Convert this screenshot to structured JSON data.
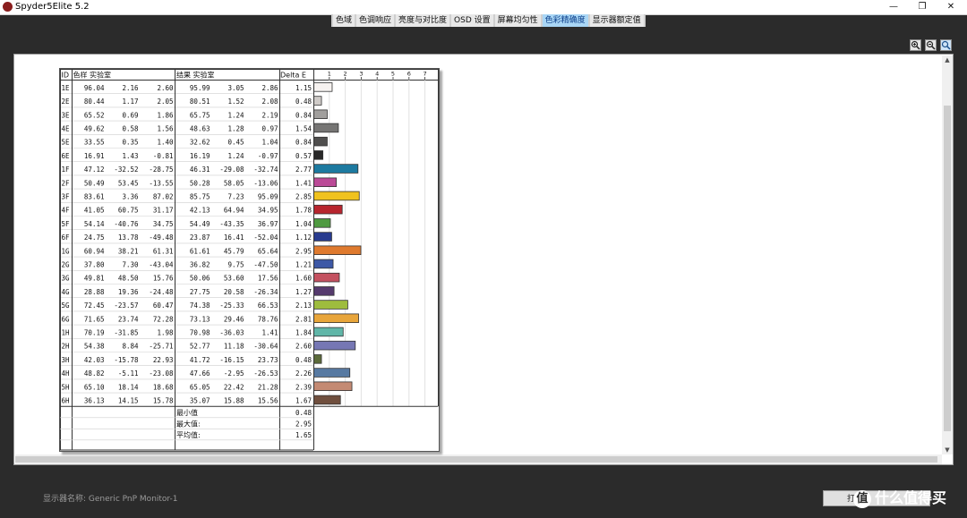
{
  "window": {
    "title": "Spyder5Elite 5.2",
    "minimize_glyph": "—",
    "restore_glyph": "❐",
    "close_glyph": "✕"
  },
  "tabs": [
    {
      "label": "色域",
      "active": false
    },
    {
      "label": "色调响应",
      "active": false
    },
    {
      "label": "亮度与对比度",
      "active": false
    },
    {
      "label": "OSD 设置",
      "active": false
    },
    {
      "label": "屏幕均匀性",
      "active": false
    },
    {
      "label": "色彩精确度",
      "active": true
    },
    {
      "label": "显示器额定值",
      "active": false
    }
  ],
  "toolbar": {
    "icons": [
      "zoom-in-icon",
      "zoom-out-icon",
      "zoom-fit-icon"
    ]
  },
  "report": {
    "headers": {
      "id": "ID",
      "sample": "色样 实验室",
      "result": "结果 实验室",
      "delta": "Delta E"
    },
    "scale_ticks": [
      "1",
      "2",
      "3",
      "4",
      "5",
      "6",
      "7"
    ],
    "rows": [
      {
        "id": "1E",
        "sample": [
          "96.04",
          "2.16",
          "2.60"
        ],
        "result": [
          "95.99",
          "3.05",
          "2.86"
        ],
        "delta": "1.15",
        "color": "#f6f2f0"
      },
      {
        "id": "2E",
        "sample": [
          "80.44",
          "1.17",
          "2.05"
        ],
        "result": [
          "80.51",
          "1.52",
          "2.08"
        ],
        "delta": "0.48",
        "color": "#cfcbc8"
      },
      {
        "id": "3E",
        "sample": [
          "65.52",
          "0.69",
          "1.86"
        ],
        "result": [
          "65.75",
          "1.24",
          "2.19"
        ],
        "delta": "0.84",
        "color": "#a19f9d"
      },
      {
        "id": "4E",
        "sample": [
          "49.62",
          "0.58",
          "1.56"
        ],
        "result": [
          "48.63",
          "1.28",
          "0.97"
        ],
        "delta": "1.54",
        "color": "#767574"
      },
      {
        "id": "5E",
        "sample": [
          "33.55",
          "0.35",
          "1.40"
        ],
        "result": [
          "32.62",
          "0.45",
          "1.04"
        ],
        "delta": "0.84",
        "color": "#4f4e4d"
      },
      {
        "id": "6E",
        "sample": [
          "16.91",
          "1.43",
          "-0.81"
        ],
        "result": [
          "16.19",
          "1.24",
          "-0.97"
        ],
        "delta": "0.57",
        "color": "#292828"
      },
      {
        "id": "1F",
        "sample": [
          "47.12",
          "-32.52",
          "-28.75"
        ],
        "result": [
          "46.31",
          "-29.08",
          "-32.74"
        ],
        "delta": "2.77",
        "color": "#1d7aa0"
      },
      {
        "id": "2F",
        "sample": [
          "50.49",
          "53.45",
          "-13.55"
        ],
        "result": [
          "50.28",
          "58.05",
          "-13.06"
        ],
        "delta": "1.41",
        "color": "#bb4a97"
      },
      {
        "id": "3F",
        "sample": [
          "83.61",
          "3.36",
          "87.02"
        ],
        "result": [
          "85.75",
          "7.23",
          "95.09"
        ],
        "delta": "2.85",
        "color": "#f0c21e"
      },
      {
        "id": "4F",
        "sample": [
          "41.05",
          "60.75",
          "31.17"
        ],
        "result": [
          "42.13",
          "64.94",
          "34.95"
        ],
        "delta": "1.78",
        "color": "#b8252e"
      },
      {
        "id": "5F",
        "sample": [
          "54.14",
          "-40.76",
          "34.75"
        ],
        "result": [
          "54.49",
          "-43.35",
          "36.97"
        ],
        "delta": "1.04",
        "color": "#4f9a41"
      },
      {
        "id": "6F",
        "sample": [
          "24.75",
          "13.78",
          "-49.48"
        ],
        "result": [
          "23.87",
          "16.41",
          "-52.04"
        ],
        "delta": "1.12",
        "color": "#283b8e"
      },
      {
        "id": "1G",
        "sample": [
          "60.94",
          "38.21",
          "61.31"
        ],
        "result": [
          "61.61",
          "45.79",
          "65.64"
        ],
        "delta": "2.95",
        "color": "#df7a2e"
      },
      {
        "id": "2G",
        "sample": [
          "37.80",
          "7.30",
          "-43.04"
        ],
        "result": [
          "36.82",
          "9.75",
          "-47.50"
        ],
        "delta": "1.21",
        "color": "#3d58a6"
      },
      {
        "id": "3G",
        "sample": [
          "49.81",
          "48.50",
          "15.76"
        ],
        "result": [
          "50.06",
          "53.60",
          "17.56"
        ],
        "delta": "1.60",
        "color": "#c45160"
      },
      {
        "id": "4G",
        "sample": [
          "28.88",
          "19.36",
          "-24.48"
        ],
        "result": [
          "27.75",
          "20.58",
          "-26.34"
        ],
        "delta": "1.27",
        "color": "#553a6d"
      },
      {
        "id": "5G",
        "sample": [
          "72.45",
          "-23.57",
          "60.47"
        ],
        "result": [
          "74.38",
          "-25.33",
          "66.53"
        ],
        "delta": "2.13",
        "color": "#9ebc3e"
      },
      {
        "id": "6G",
        "sample": [
          "71.65",
          "23.74",
          "72.28"
        ],
        "result": [
          "73.13",
          "29.46",
          "78.76"
        ],
        "delta": "2.81",
        "color": "#e8a53a"
      },
      {
        "id": "1H",
        "sample": [
          "70.19",
          "-31.85",
          "1.98"
        ],
        "result": [
          "70.98",
          "-36.03",
          "1.41"
        ],
        "delta": "1.84",
        "color": "#60b6a8"
      },
      {
        "id": "2H",
        "sample": [
          "54.38",
          "8.84",
          "-25.71"
        ],
        "result": [
          "52.77",
          "11.18",
          "-30.64"
        ],
        "delta": "2.60",
        "color": "#7677b4"
      },
      {
        "id": "3H",
        "sample": [
          "42.03",
          "-15.78",
          "22.93"
        ],
        "result": [
          "41.72",
          "-16.15",
          "23.73"
        ],
        "delta": "0.48",
        "color": "#5c6b3a"
      },
      {
        "id": "4H",
        "sample": [
          "48.82",
          "-5.11",
          "-23.08"
        ],
        "result": [
          "47.66",
          "-2.95",
          "-26.53"
        ],
        "delta": "2.26",
        "color": "#587aa2"
      },
      {
        "id": "5H",
        "sample": [
          "65.10",
          "18.14",
          "18.68"
        ],
        "result": [
          "65.05",
          "22.42",
          "21.28"
        ],
        "delta": "2.39",
        "color": "#c48a73"
      },
      {
        "id": "6H",
        "sample": [
          "36.13",
          "14.15",
          "15.78"
        ],
        "result": [
          "35.07",
          "15.88",
          "15.56"
        ],
        "delta": "1.67",
        "color": "#704f3e"
      }
    ],
    "summary": [
      {
        "label": "最小值",
        "value": "0.48"
      },
      {
        "label": "最大值:",
        "value": "2.95"
      },
      {
        "label": "平均值:",
        "value": "1.65"
      }
    ]
  },
  "footer": {
    "monitor_name": "显示器名称: Generic PnP Monitor-1",
    "button_label": "打"
  },
  "watermark": {
    "glyph": "值",
    "text": "什么值得买"
  }
}
